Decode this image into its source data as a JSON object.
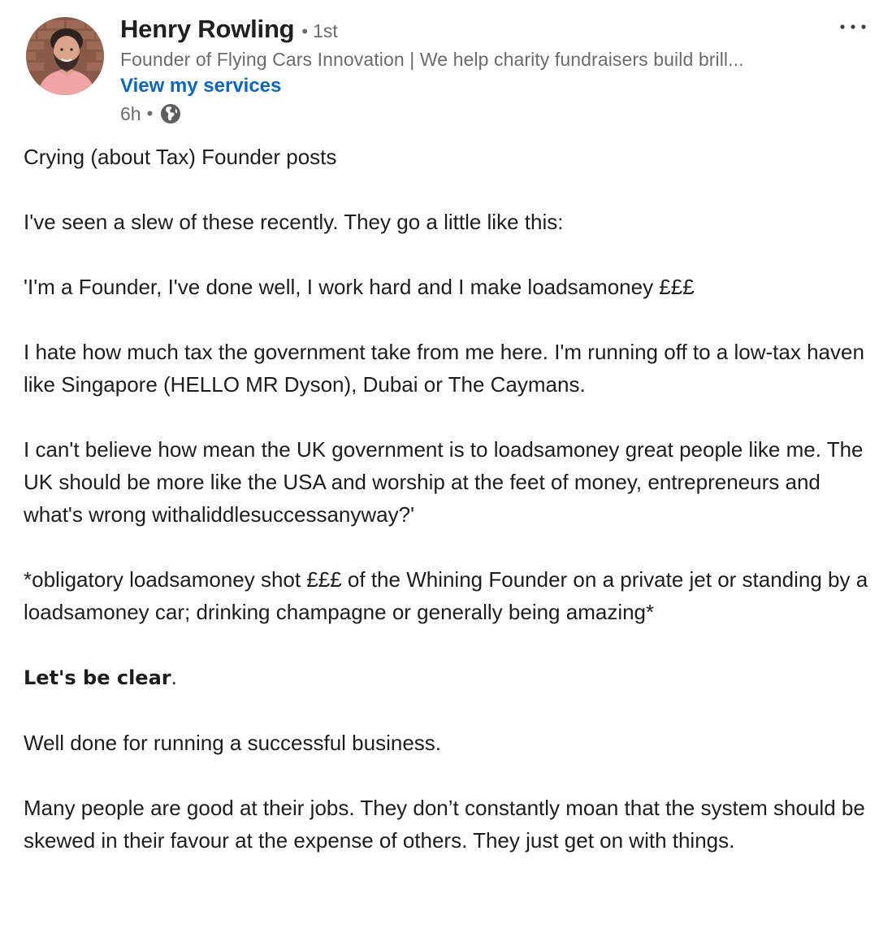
{
  "author": {
    "name": "Henry Rowling",
    "degree_separator": "•",
    "degree": "1st",
    "headline": "Founder of Flying Cars Innovation | We help charity fundraisers build brill...",
    "services_link": "View my services"
  },
  "meta": {
    "timestamp": "6h",
    "separator": "•",
    "visibility_icon": "globe-icon"
  },
  "menu": {
    "icon": "more-horizontal-icon"
  },
  "colors": {
    "link": "#0a66c2",
    "secondary_text": "#6b6b6b",
    "body_text": "#1d1d1d"
  },
  "post": {
    "title": "Crying (about Tax) Founder posts",
    "p1": "I've seen a slew of these recently. They go a little like this:",
    "p2": "'I'm a Founder, I've done well, I work hard and I make loadsamoney £££",
    "p3": "I hate how much tax the government take from me here. I'm running off to a low-tax haven like Singapore (HELLO MR Dyson), Dubai or The Caymans.",
    "p4": "I can't believe how mean the UK government is to loadsamoney great people like me. The UK should be more like the USA and worship at the feet of money, entrepreneurs and what's wrong withaliddlesuccessanyway?'",
    "p5": "*obligatory loadsamoney shot £££ of the Whining Founder on a private jet or standing by a loadsamoney car; drinking champagne or generally being amazing*",
    "p6_strong": "Let's be clear",
    "p6_suffix": ".",
    "p7": "Well done for running a successful business.",
    "p8": "Many people are good at their jobs. They don’t constantly moan that the system should be skewed in their favour at the expense of others. They just get on with things."
  }
}
